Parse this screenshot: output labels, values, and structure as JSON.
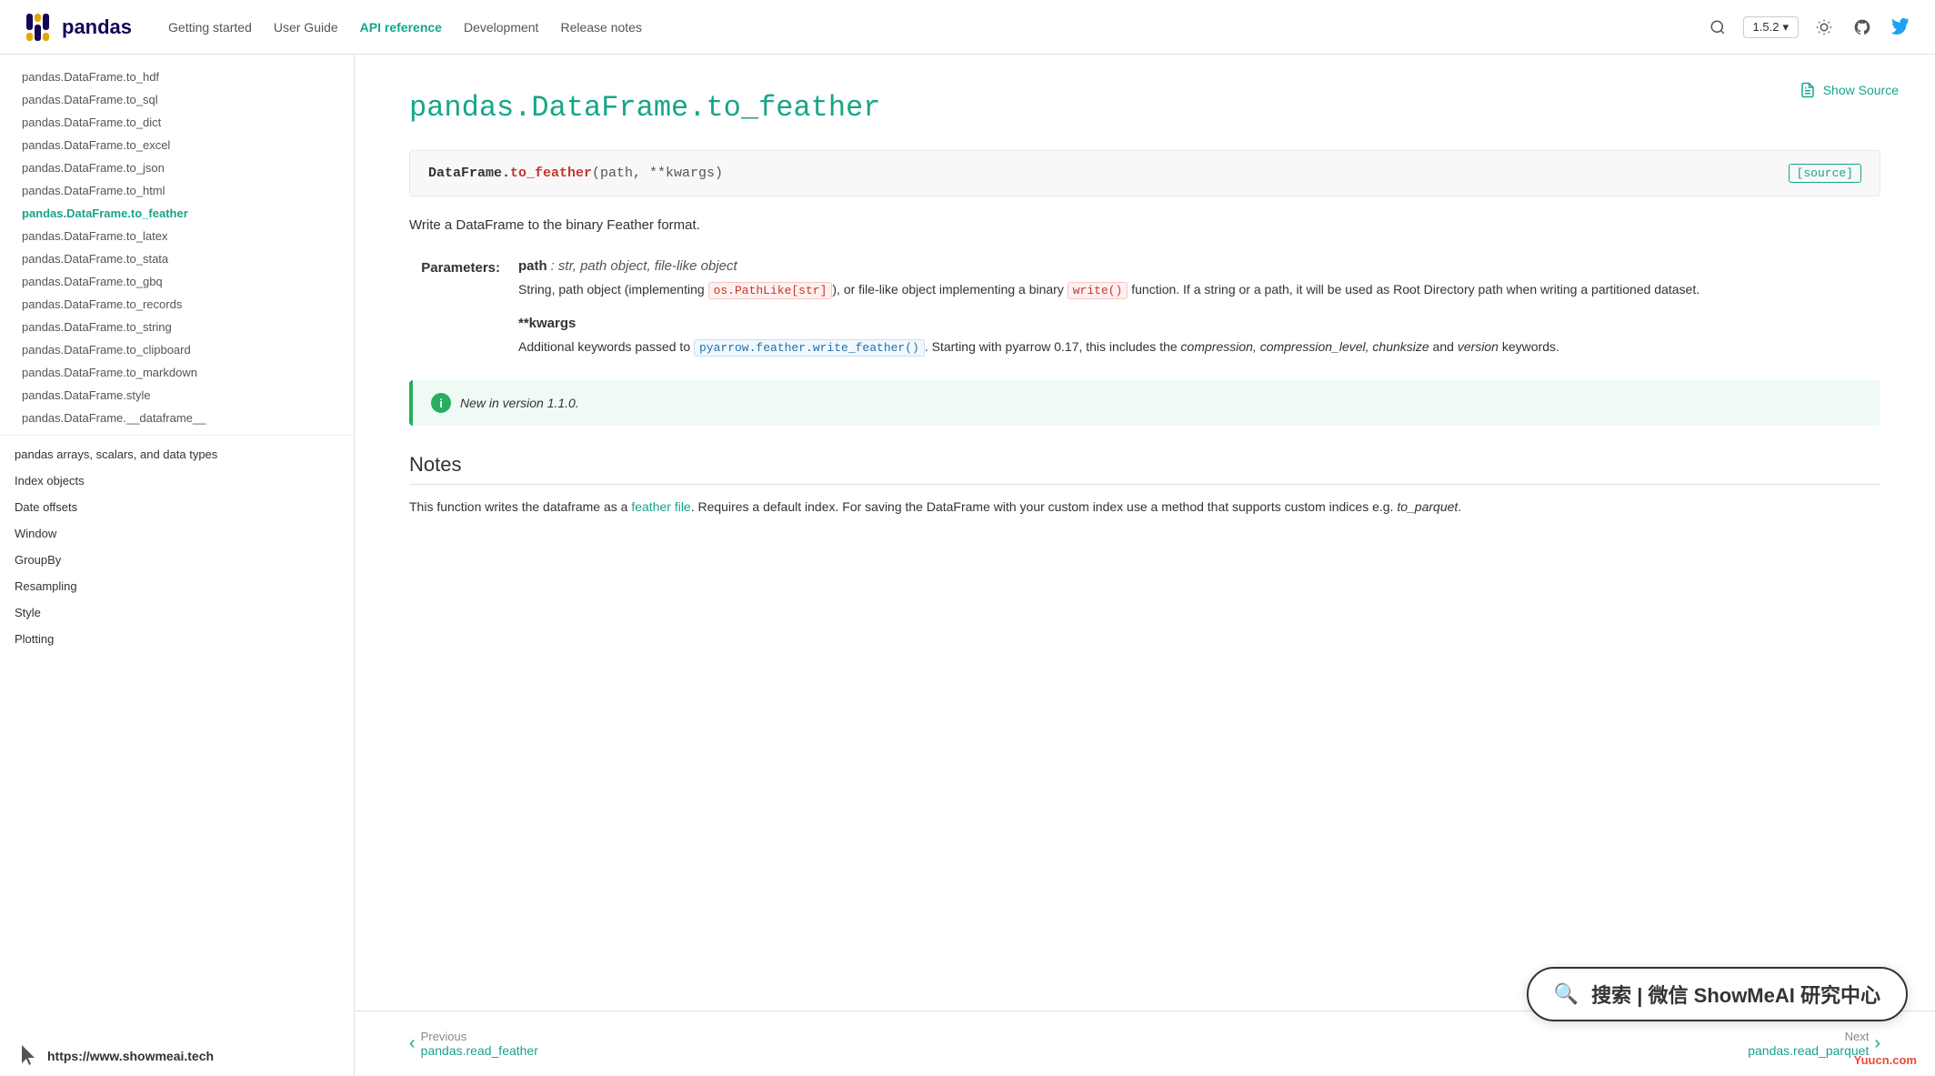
{
  "nav": {
    "logo_text": "pandas",
    "links": [
      {
        "label": "Getting started",
        "active": false
      },
      {
        "label": "User Guide",
        "active": false
      },
      {
        "label": "API reference",
        "active": true
      },
      {
        "label": "Development",
        "active": false
      },
      {
        "label": "Release notes",
        "active": false
      }
    ],
    "version": "1.5.2"
  },
  "sidebar": {
    "items": [
      {
        "label": "pandas.DataFrame.to_hdf",
        "active": false,
        "type": "item"
      },
      {
        "label": "pandas.DataFrame.to_sql",
        "active": false,
        "type": "item"
      },
      {
        "label": "pandas.DataFrame.to_dict",
        "active": false,
        "type": "item"
      },
      {
        "label": "pandas.DataFrame.to_excel",
        "active": false,
        "type": "item"
      },
      {
        "label": "pandas.DataFrame.to_json",
        "active": false,
        "type": "item"
      },
      {
        "label": "pandas.DataFrame.to_html",
        "active": false,
        "type": "item"
      },
      {
        "label": "pandas.DataFrame.to_feather",
        "active": true,
        "type": "item"
      },
      {
        "label": "pandas.DataFrame.to_latex",
        "active": false,
        "type": "item"
      },
      {
        "label": "pandas.DataFrame.to_stata",
        "active": false,
        "type": "item"
      },
      {
        "label": "pandas.DataFrame.to_gbq",
        "active": false,
        "type": "item"
      },
      {
        "label": "pandas.DataFrame.to_records",
        "active": false,
        "type": "item"
      },
      {
        "label": "pandas.DataFrame.to_string",
        "active": false,
        "type": "item"
      },
      {
        "label": "pandas.DataFrame.to_clipboard",
        "active": false,
        "type": "item"
      },
      {
        "label": "pandas.DataFrame.to_markdown",
        "active": false,
        "type": "item"
      },
      {
        "label": "pandas.DataFrame.style",
        "active": false,
        "type": "item"
      },
      {
        "label": "pandas.DataFrame.__dataframe__",
        "active": false,
        "type": "item"
      },
      {
        "label": "pandas arrays, scalars, and data types",
        "active": false,
        "type": "section"
      },
      {
        "label": "Index objects",
        "active": false,
        "type": "section"
      },
      {
        "label": "Date offsets",
        "active": false,
        "type": "section"
      },
      {
        "label": "Window",
        "active": false,
        "type": "section"
      },
      {
        "label": "GroupBy",
        "active": false,
        "type": "section"
      },
      {
        "label": "Resampling",
        "active": false,
        "type": "section"
      },
      {
        "label": "Style",
        "active": false,
        "type": "section"
      },
      {
        "label": "Plotting",
        "active": false,
        "type": "section"
      }
    ]
  },
  "page": {
    "title": "pandas.DataFrame.to_feather",
    "show_source_label": "Show Source",
    "signature": {
      "class": "DataFrame.",
      "method": "to_feather",
      "params": "(path, **kwargs)"
    },
    "source_link": "[source]",
    "description": "Write a DataFrame to the binary Feather format.",
    "params_label": "Parameters:",
    "param_path_name": "path",
    "param_path_type": ": str, path object, file-like object",
    "param_path_desc_pre": "String, path object (implementing ",
    "code_ospathlike": "os.PathLike[str]",
    "param_path_desc_mid": "), or file-like object implementing a binary ",
    "code_write": "write()",
    "param_path_desc_post": " function. If a string or a path, it will be used as Root Directory path when writing a partitioned dataset.",
    "param_kwargs_name": "**kwargs",
    "param_kwargs_desc_pre": "Additional keywords passed to ",
    "code_pyarrow": "pyarrow.feather.write_feather()",
    "param_kwargs_desc_post": ". Starting with pyarrow 0.17, this includes the ",
    "kwargs_italic": "compression, compression_level, chunksize",
    "kwargs_post": " and ",
    "kwargs_italic2": "version",
    "kwargs_post2": " keywords.",
    "version_note": "New in version 1.1.0.",
    "notes_title": "Notes",
    "notes_text_pre": "This function writes the dataframe as a ",
    "notes_link": "feather file",
    "notes_text_mid": ". Requires a default index. For saving the DataFrame with your custom index use a method that supports custom indices e.g. ",
    "notes_italic": "to_parquet",
    "notes_text_post": "."
  },
  "bottom_nav": {
    "prev_label": "Previous",
    "prev_link": "pandas.read_feather",
    "next_label": "Next",
    "next_link": "pandas.read_parquet"
  },
  "watermark": {
    "text": "搜索 | 微信 ShowMeAI 研究中心",
    "url": "https://www.showmeai.tech",
    "yuucn": "Yuucn.com"
  }
}
